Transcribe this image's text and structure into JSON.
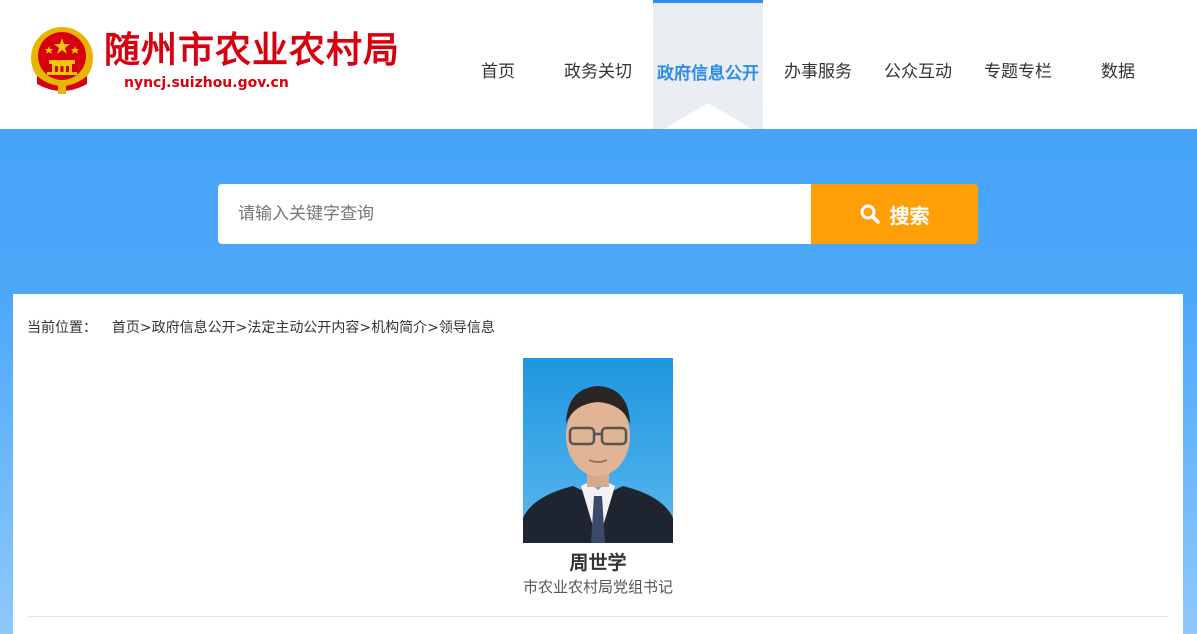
{
  "header": {
    "site_title": "随州市农业农村局",
    "site_domain": "nyncj.suizhou.gov.cn"
  },
  "nav": {
    "items": [
      {
        "label": "首页"
      },
      {
        "label": "政务关切"
      },
      {
        "label": "政府信息公开"
      },
      {
        "label": "办事服务"
      },
      {
        "label": "公众互动"
      },
      {
        "label": "专题专栏"
      },
      {
        "label": "数据"
      }
    ],
    "active": "政府信息公开"
  },
  "search": {
    "placeholder": "请输入关键字查询",
    "value": "",
    "button_label": "搜索"
  },
  "breadcrumb": {
    "prefix": "当前位置：",
    "items": [
      "首页",
      "政府信息公开",
      "法定主动公开内容",
      "机构简介",
      "领导信息"
    ],
    "separator": ">"
  },
  "leader": {
    "name": "周世学",
    "title": "市农业农村局党组书记"
  },
  "colors": {
    "brand_red": "#d7000f",
    "nav_active": "#2d8cf0",
    "search_button": "#ff9f07",
    "banner_blue": "#3e9ff8"
  }
}
